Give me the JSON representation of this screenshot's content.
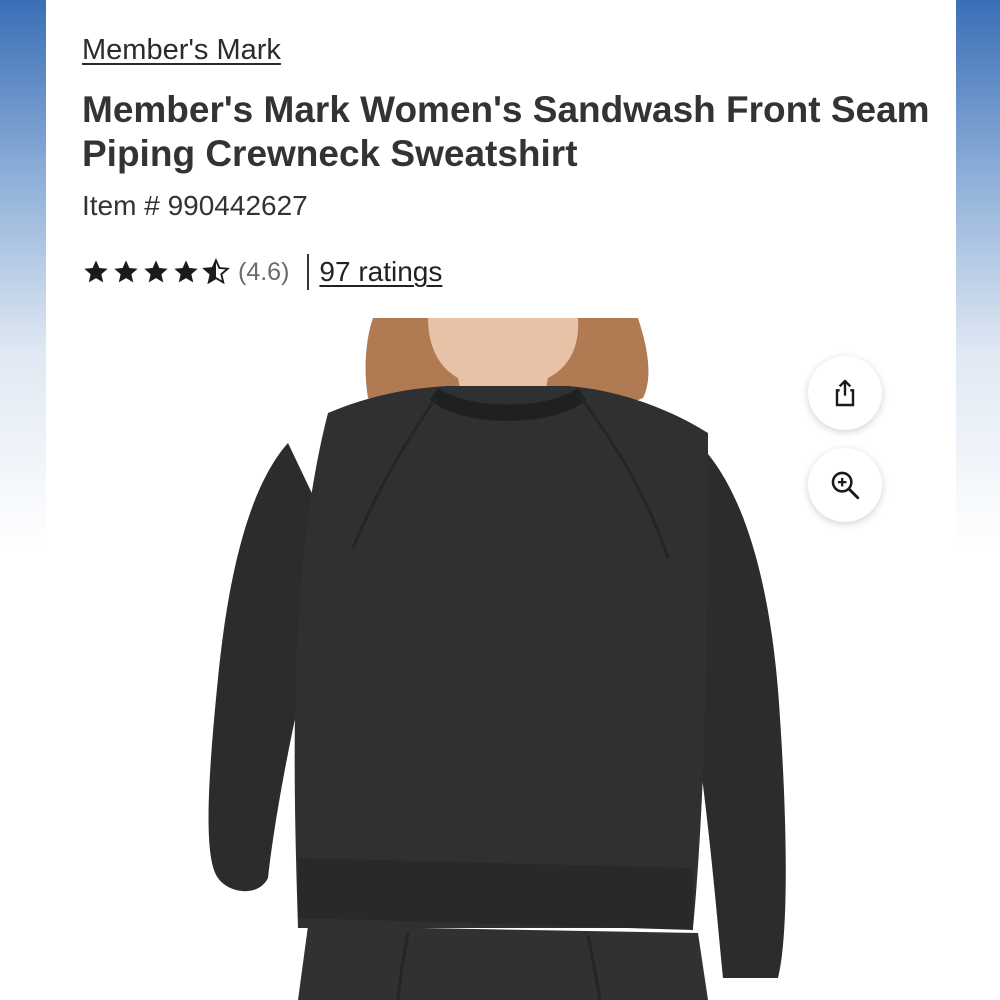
{
  "product": {
    "brand": "Member's Mark",
    "title": "Member's Mark Women's Sandwash Front Seam Piping Crewneck Sweatshirt",
    "item_number": "Item # 990442627",
    "rating_value": 4.6,
    "rating_text": "(4.6)",
    "ratings_count_label": "97 ratings"
  },
  "actions": {
    "share_icon": "share-icon",
    "zoom_icon": "zoom-in-icon"
  },
  "image": {
    "subject": "black crewneck sweatshirt worn by model"
  },
  "colors": {
    "text": "#333333",
    "star": "#1a1a1a",
    "sweatshirt": "#2e2f31",
    "side_gradient_top": "#3a6fb6"
  }
}
